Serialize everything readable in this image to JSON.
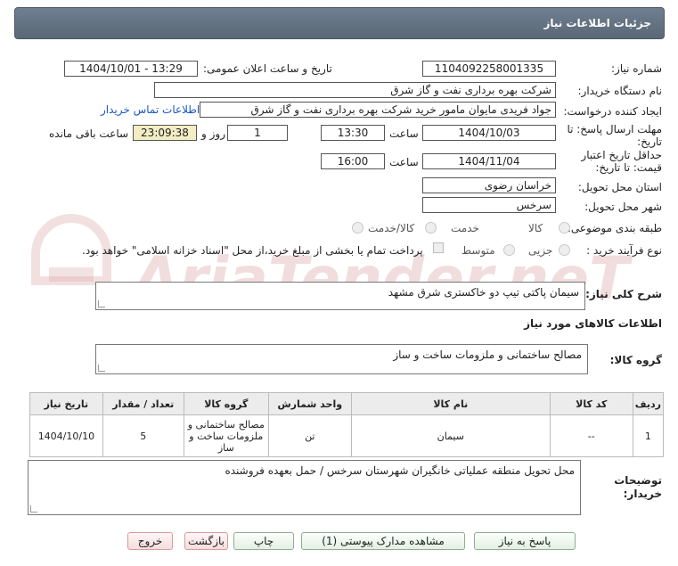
{
  "header": {
    "title": "جزئیات اطلاعات نیاز"
  },
  "fields": {
    "need_number_label": "شماره نیاز:",
    "need_number": "1104092258001335",
    "announce_label": "تاریخ و ساعت اعلان عمومی:",
    "announce_value": "1404/10/01 - 13:29",
    "buyer_org_label": "نام دستگاه خریدار:",
    "buyer_org": "شرکت بهره برداری نفت و گاز شرق",
    "requester_label": "ایجاد کننده درخواست:",
    "requester": "جواد فریدی مایوان مامور خرید شرکت بهره برداری نفت و گاز شرق",
    "contact_link": "اطلاعات تماس خریدار",
    "reply_deadline_label": "مهلت ارسال پاسخ: تا تاریخ:",
    "reply_date": "1404/10/03",
    "time_label": "ساعت",
    "reply_time": "13:30",
    "days_value": "1",
    "days_label": "روز و",
    "remaining_time": "23:09:38",
    "remaining_label": "ساعت باقی مانده",
    "validity_label": "حداقل تاریخ اعتبار قیمت: تا تاریخ:",
    "validity_date": "1404/11/04",
    "validity_time_label": "ساعت",
    "validity_time": "16:00",
    "province_label": "استان محل تحویل:",
    "province": "خراسان رضوی",
    "city_label": "شهر محل تحویل:",
    "city": "سرخس",
    "category_label": "طبقه بندی موضوعی:",
    "category_options": [
      "کالا",
      "خدمت",
      "کالا/خدمت"
    ],
    "process_label": "نوع فرآیند خرید :",
    "process_options": [
      "جزیی",
      "متوسط"
    ],
    "payment_note": "پرداخت تمام یا بخشی از مبلغ خرید،از محل \"اسناد خزانه اسلامی\" خواهد بود."
  },
  "description": {
    "label": "شرح کلی نیاز:",
    "value": "سیمان پاکتی تیپ دو خاکستری شرق مشهد"
  },
  "goods_section": {
    "title": "اطلاعات کالاهای مورد نیاز",
    "group_label": "گروه کالا:",
    "group_value": "مصالح ساختمانی و ملزومات ساخت و ساز"
  },
  "table": {
    "headers": [
      "ردیف",
      "کد کالا",
      "نام کالا",
      "واحد شمارش",
      "گروه کالا",
      "تعداد / مقدار",
      "تاریخ نیاز"
    ],
    "rows": [
      [
        "1",
        "--",
        "سیمان",
        "تن",
        "مصالح ساختمانی و ملزومات ساخت و ساز",
        "5",
        "1404/10/10"
      ]
    ]
  },
  "buyer_notes": {
    "label": "توضیحات خریدار:",
    "value": "محل تحویل منطقه عملیاتی خانگیران شهرستان سرخس / حمل بعهده فروشنده"
  },
  "buttons": {
    "reply": "پاسخ به نیاز",
    "documents": "مشاهده مدارک پیوستی (1)",
    "print": "چاپ",
    "back": "بازگشت",
    "exit": "خروج"
  },
  "colors": {
    "header_bg": "#5f6e7d",
    "link": "#1a57c4",
    "yellow_box": "#f3edc4",
    "watermark": "#e8c9c9"
  }
}
